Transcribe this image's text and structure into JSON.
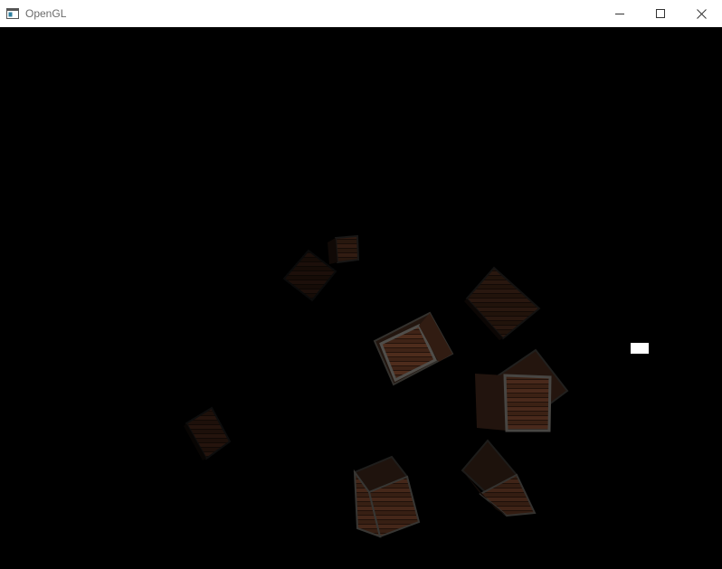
{
  "window": {
    "title": "OpenGL",
    "app_icon": "window-app-icon",
    "controls": {
      "minimize_icon": "minimize-icon",
      "maximize_icon": "maximize-icon",
      "close_icon": "close-icon"
    }
  },
  "scene": {
    "background_color": "#000000",
    "light_color": "#ffffff",
    "crate_colors": {
      "plank": "#5a3220",
      "plank_dark": "#3a2016",
      "frame": "#3c3a36",
      "side": "#241610"
    }
  }
}
